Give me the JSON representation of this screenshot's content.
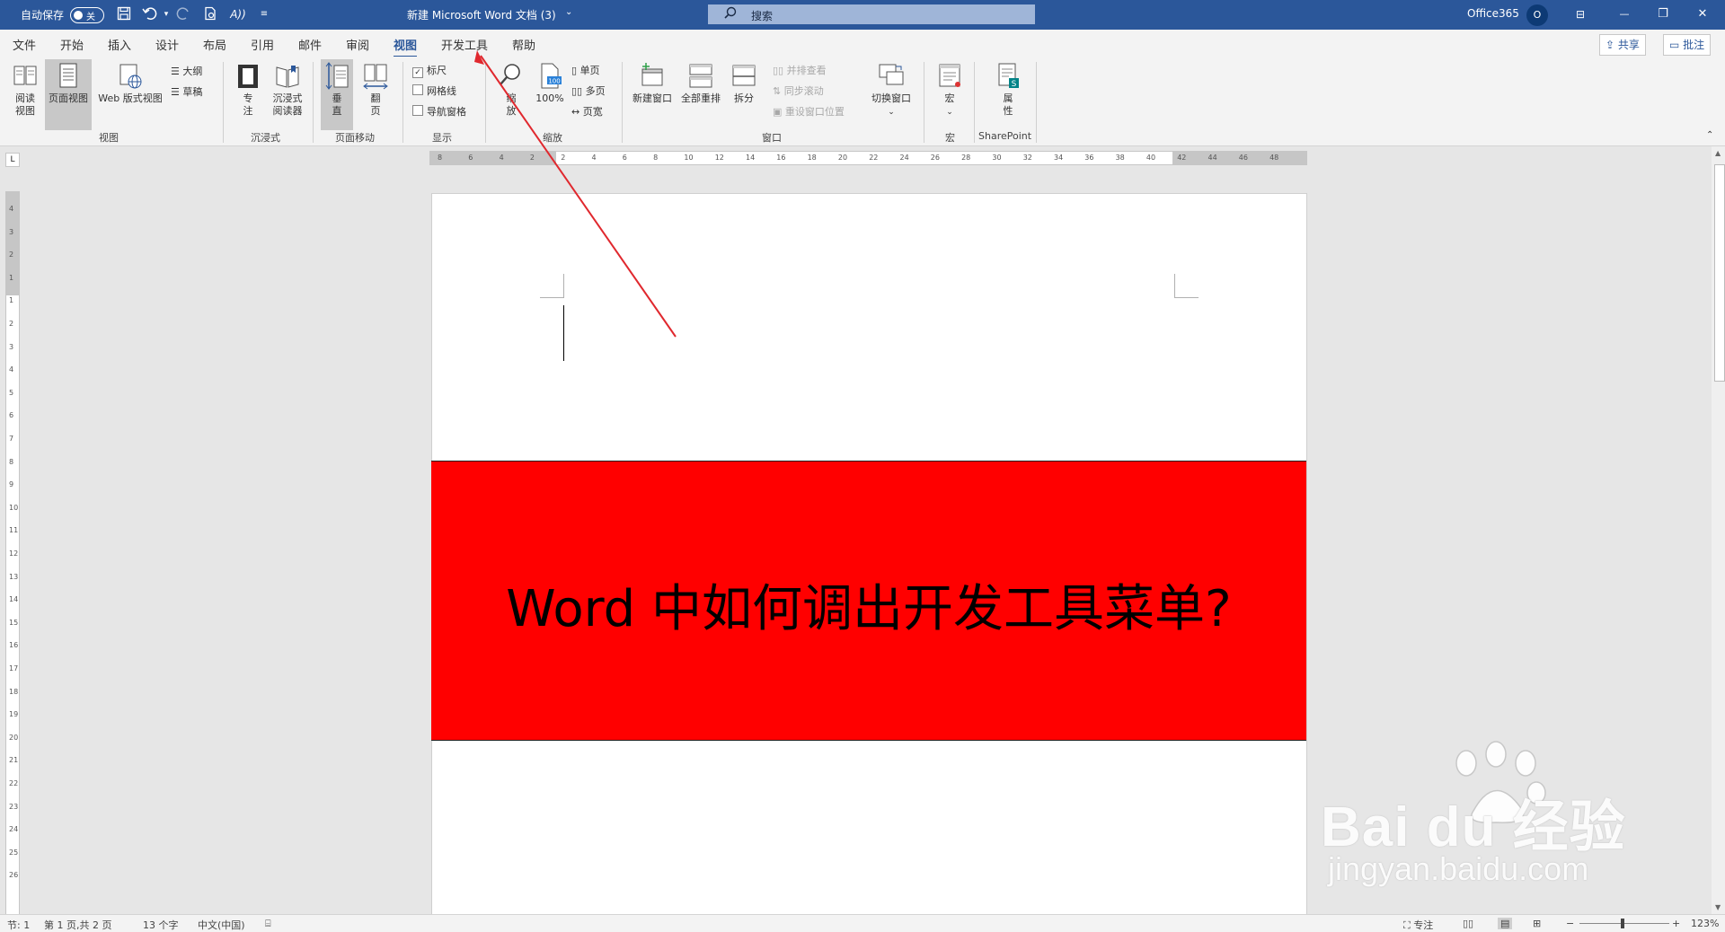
{
  "titlebar": {
    "autosave_label": "自动保存",
    "autosave_state": "关",
    "doc_title": "新建 Microsoft Word 文档 (3)",
    "title_dropdown": "⌄",
    "search_placeholder": "搜索",
    "account_name": "Office365",
    "avatar_initial": "O",
    "min_icon": "—",
    "restore_icon": "❐",
    "close_icon": "✕",
    "ribbon_display_icon": "⊟"
  },
  "tabs": [
    "文件",
    "开始",
    "插入",
    "设计",
    "布局",
    "引用",
    "邮件",
    "审阅",
    "视图",
    "开发工具",
    "帮助"
  ],
  "tabs_right": {
    "share": "共享",
    "comments": "批注"
  },
  "ribbon": {
    "views": {
      "read": "阅读\n视图",
      "print": "页面视图",
      "web": "Web 版式视图",
      "outline": "大纲",
      "draft": "草稿",
      "group": "视图"
    },
    "immersive": {
      "focus": "专\n注",
      "reader": "沉浸式\n阅读器",
      "group": "沉浸式"
    },
    "page_move": {
      "vertical": "垂\n直",
      "side": "翻\n页",
      "group": "页面移动"
    },
    "show": {
      "ruler": "标尺",
      "gridlines": "网格线",
      "nav": "导航窗格",
      "group": "显示",
      "ruler_checked": true,
      "gridlines_checked": false,
      "nav_checked": false
    },
    "zoom": {
      "zoom": "缩\n放",
      "pct": "100%",
      "one_page": "单页",
      "multi_page": "多页",
      "page_width": "页宽",
      "group": "缩放",
      "badge": "100"
    },
    "window": {
      "new": "新建窗口",
      "arrange": "全部重排",
      "split": "拆分",
      "side_by_side": "并排查看",
      "sync_scroll": "同步滚动",
      "reset_pos": "重设窗口位置",
      "switch": "切换窗口",
      "group": "窗口"
    },
    "macros": {
      "macro": "宏",
      "group": "宏"
    },
    "sharepoint": {
      "properties": "属\n性",
      "group": "SharePoint"
    }
  },
  "ruler": {
    "h_numbers": [
      "8",
      "6",
      "4",
      "2",
      "2",
      "4",
      "6",
      "8",
      "10",
      "12",
      "14",
      "16",
      "18",
      "20",
      "22",
      "24",
      "26",
      "28",
      "30",
      "32",
      "34",
      "36",
      "38",
      "40",
      "42",
      "44",
      "46",
      "48"
    ],
    "v_numbers": [
      "4",
      "3",
      "2",
      "1",
      "1",
      "2",
      "3",
      "4",
      "5",
      "6",
      "7",
      "8",
      "9",
      "10",
      "11",
      "12",
      "13",
      "14",
      "15",
      "16",
      "17",
      "18",
      "19",
      "20",
      "21",
      "22",
      "23",
      "24",
      "25",
      "26"
    ],
    "corner_symbol": "L"
  },
  "document": {
    "banner_text": "Word 中如何调出开发工具菜单?",
    "banner_color": "#ff0000"
  },
  "status": {
    "section": "节: 1",
    "page": "第 1 页,共 2 页",
    "words": "13 个字",
    "language": "中文(中国)",
    "focus": "专注",
    "zoom_pct": "123%",
    "zoom_minus": "−",
    "zoom_plus": "+"
  },
  "watermark": {
    "line1": "Bai du 经验",
    "line2": "jingyan.baidu.com"
  },
  "colors": {
    "title_bar": "#2b579a",
    "annotation_arrow": "#e0282e"
  }
}
